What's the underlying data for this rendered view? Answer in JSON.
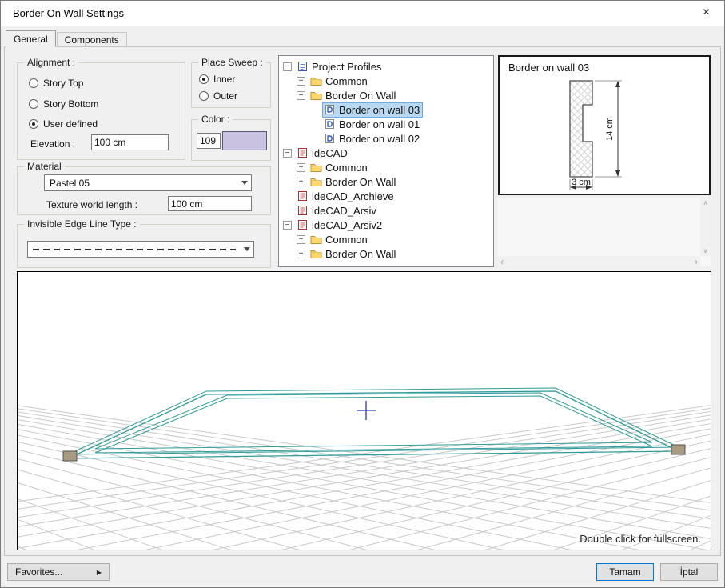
{
  "window": {
    "title": "Border On Wall Settings",
    "close_glyph": "×"
  },
  "tabs": {
    "general": "General",
    "components": "Components"
  },
  "alignment": {
    "legend": "Alignment :",
    "options": [
      {
        "label": "Story Top",
        "selected": false
      },
      {
        "label": "Story Bottom",
        "selected": false
      },
      {
        "label": "User defined",
        "selected": true
      }
    ],
    "elevation_label": "Elevation :",
    "elevation_value": "100 cm"
  },
  "place_sweep": {
    "legend": "Place Sweep :",
    "options": [
      {
        "label": "Inner",
        "selected": true
      },
      {
        "label": "Outer",
        "selected": false
      }
    ]
  },
  "color": {
    "legend": "Color :",
    "index": "109",
    "swatch_hex": "#c9c2e0"
  },
  "material": {
    "legend": "Material",
    "selected": "Pastel 05",
    "texture_label": "Texture world length :",
    "texture_value": "100 cm"
  },
  "invisible_edge": {
    "legend": "Invisible Edge Line Type :",
    "selected_line_type": "dashed"
  },
  "tree": {
    "items": [
      {
        "label": "Project Profiles",
        "icon": "doc",
        "indent": 0,
        "expander": "minus",
        "selected": false
      },
      {
        "label": "Common",
        "icon": "folder",
        "indent": 1,
        "expander": "plus",
        "selected": false
      },
      {
        "label": "Border On Wall",
        "icon": "folder",
        "indent": 1,
        "expander": "minus",
        "selected": false
      },
      {
        "label": "Border on wall 03",
        "icon": "profile",
        "indent": 2,
        "expander": "none",
        "selected": true
      },
      {
        "label": "Border on wall 01",
        "icon": "profile",
        "indent": 2,
        "expander": "none",
        "selected": false
      },
      {
        "label": "Border on wall 02",
        "icon": "profile",
        "indent": 2,
        "expander": "none",
        "selected": false
      },
      {
        "label": "ideCAD",
        "icon": "book",
        "indent": 0,
        "expander": "minus",
        "selected": false
      },
      {
        "label": "Common",
        "icon": "folder",
        "indent": 1,
        "expander": "plus",
        "selected": false
      },
      {
        "label": "Border On Wall",
        "icon": "folder",
        "indent": 1,
        "expander": "plus",
        "selected": false
      },
      {
        "label": "ideCAD_Archieve",
        "icon": "book",
        "indent": 0,
        "expander": "none",
        "selected": false
      },
      {
        "label": "ideCAD_Arsiv",
        "icon": "book",
        "indent": 0,
        "expander": "none",
        "selected": false
      },
      {
        "label": "ideCAD_Arsiv2",
        "icon": "book",
        "indent": 0,
        "expander": "minus",
        "selected": false
      },
      {
        "label": "Common",
        "icon": "folder",
        "indent": 1,
        "expander": "plus",
        "selected": false
      },
      {
        "label": "Border On Wall",
        "icon": "folder",
        "indent": 1,
        "expander": "plus",
        "selected": false
      }
    ]
  },
  "preview": {
    "title": "Border on wall 03",
    "dim_vertical": "14 cm",
    "dim_horizontal": "3 cm"
  },
  "viewport": {
    "hint": "Double click for fullscreen."
  },
  "footer": {
    "favorites": "Favorites...",
    "ok": "Tamam",
    "cancel": "İptal"
  },
  "colors": {
    "sweep_teal": "#2f9a9a",
    "grid_line": "#c9c9c9",
    "selection_blue": "#b9d9f2",
    "accent_blue": "#0078d7",
    "cross_blue": "#2b36c4"
  }
}
